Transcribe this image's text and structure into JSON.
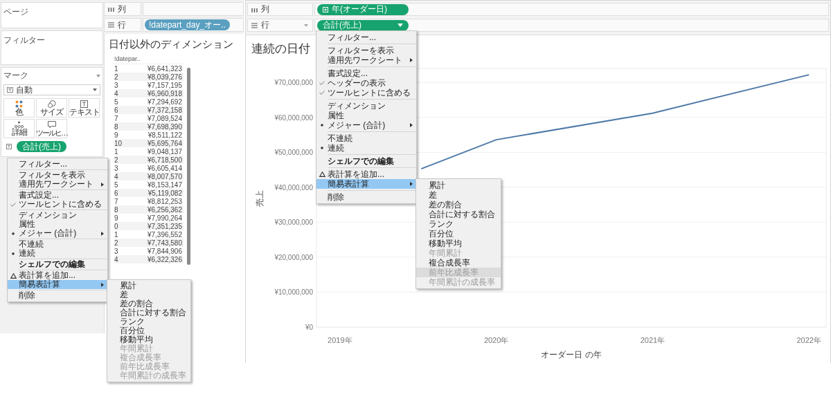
{
  "left": {
    "pages_card": {
      "title": "ページ"
    },
    "filters_card": {
      "title": "フィルター"
    },
    "marks_card": {
      "title": "マーク",
      "mark_type": "自動",
      "buttons": [
        {
          "label": "色",
          "kind": "color"
        },
        {
          "label": "サイズ",
          "kind": "size"
        },
        {
          "label": "テキスト",
          "kind": "text"
        },
        {
          "label": "詳細",
          "kind": "detail"
        },
        {
          "label": "ツールヒ…",
          "kind": "tooltip"
        }
      ],
      "pill": {
        "label": "合計(売上)",
        "continuous": true
      }
    },
    "shelves": [
      {
        "label": "列",
        "kind": "columns",
        "show_caret": false
      },
      {
        "label": "行",
        "kind": "rows",
        "show_caret": false,
        "pill": {
          "label": "!datepart_day_オー..",
          "continuous": false,
          "menu_open": false
        }
      }
    ],
    "sheet": {
      "title": "日付以外のディメンション",
      "column_1": "!datepar..",
      "rows": [
        [
          "1",
          "¥6,641,323"
        ],
        [
          "2",
          "¥8,039,276"
        ],
        [
          "3",
          "¥7,157,195"
        ],
        [
          "4",
          "¥6,960,918"
        ],
        [
          "5",
          "¥7,294,692"
        ],
        [
          "6",
          "¥7,372,158"
        ],
        [
          "7",
          "¥7,089,524"
        ],
        [
          "8",
          "¥7,698,390"
        ],
        [
          "9",
          "¥8,511,122"
        ],
        [
          "10",
          "¥5,695,764"
        ],
        [
          "1",
          "¥9,048,137"
        ],
        [
          "2",
          "¥6,718,500"
        ],
        [
          "3",
          "¥6,605,414"
        ],
        [
          "4",
          "¥8,007,570"
        ],
        [
          "5",
          "¥8,153,147"
        ],
        [
          "6",
          "¥5,119,082"
        ],
        [
          "7",
          "¥8,812,253"
        ],
        [
          "8",
          "¥6,256,362"
        ],
        [
          "9",
          "¥7,990,264"
        ],
        [
          "0",
          "¥7,351,235"
        ],
        [
          "1",
          "¥7,396,552"
        ],
        [
          "2",
          "¥7,743,580"
        ],
        [
          "3",
          "¥7,844,906"
        ],
        [
          "4",
          "¥6,322,326"
        ]
      ]
    },
    "menu": {
      "groups": [
        [
          {
            "label": "フィルター...",
            "kind": "plain",
            "selected": false
          }
        ],
        [
          {
            "label": "フィルターを表示",
            "kind": "plain",
            "selected": false
          },
          {
            "label": "適用先ワークシート",
            "kind": "plain",
            "submenu": true,
            "selected": false
          }
        ],
        [
          {
            "label": "書式設定...",
            "kind": "plain",
            "selected": false
          },
          {
            "label": "ツールヒントに含める",
            "kind": "check",
            "selected": false
          }
        ],
        [
          {
            "label": "ディメンション",
            "kind": "plain",
            "selected": false
          },
          {
            "label": "属性",
            "kind": "plain",
            "selected": false
          },
          {
            "label": "メジャー (合計)",
            "kind": "radio",
            "submenu": true,
            "selected": false
          }
        ],
        [
          {
            "label": "不連続",
            "kind": "plain",
            "selected": false
          },
          {
            "label": "連続",
            "kind": "radio",
            "selected": false
          }
        ],
        [
          {
            "label": "シェルフでの編集",
            "kind": "plain",
            "bold": true,
            "selected": false
          }
        ],
        [
          {
            "label": "表計算を追加...",
            "kind": "calc",
            "selected": false
          },
          {
            "label": "簡易表計算",
            "kind": "plain",
            "submenu": true,
            "selected": true
          }
        ],
        [
          {
            "label": "削除",
            "kind": "plain",
            "selected": false
          }
        ]
      ]
    },
    "submenu": {
      "items": [
        {
          "label": "累計",
          "disabled": false,
          "selected": false
        },
        {
          "label": "差",
          "disabled": false,
          "selected": false
        },
        {
          "label": "差の割合",
          "disabled": false,
          "selected": false
        },
        {
          "label": "合計に対する割合",
          "disabled": false,
          "selected": false
        },
        {
          "label": "ランク",
          "disabled": false,
          "selected": false
        },
        {
          "label": "百分位",
          "disabled": false,
          "selected": false
        },
        {
          "label": "移動平均",
          "disabled": false,
          "selected": false
        },
        {
          "label": "年間累計",
          "disabled": true,
          "selected": false
        },
        {
          "label": "複合成長率",
          "disabled": true,
          "selected": false
        },
        {
          "label": "前年比成長率",
          "disabled": true,
          "selected": false
        },
        {
          "label": "年間累計の成長率",
          "disabled": true,
          "selected": false
        }
      ]
    }
  },
  "right": {
    "shelves": [
      {
        "label": "列",
        "kind": "columns",
        "show_caret": false,
        "pill": {
          "label": "年(オーダー日)",
          "continuous": true,
          "kind": "date",
          "menu_open": false
        }
      },
      {
        "label": "行",
        "kind": "rows",
        "show_caret": true,
        "pill": {
          "label": "合計(売上)",
          "continuous": true,
          "kind": "measure",
          "menu_open": true
        }
      }
    ],
    "sheet": {
      "title": "連続の日付",
      "chart_data": {
        "type": "line",
        "xlabel": "オーダー日 の年",
        "ylabel": "売上",
        "x": [
          2019.52,
          2020,
          2021,
          2022
        ],
        "series": [
          {
            "color": "#4e79a7",
            "values": [
              45300000,
              53600000,
              61200000,
              72200000
            ]
          }
        ],
        "xlim": [
          2018.85,
          2022.11
        ],
        "ylim": [
          0,
          74000000
        ],
        "grid": true,
        "xticks": [
          {
            "value": 2019,
            "label": "2019年"
          },
          {
            "value": 2020,
            "label": "2020年"
          },
          {
            "value": 2021,
            "label": "2021年"
          },
          {
            "value": 2022,
            "label": "2022年"
          }
        ],
        "yticks": [
          {
            "value": 0,
            "label": "¥0"
          },
          {
            "value": 10000000,
            "label": "¥10,000,000"
          },
          {
            "value": 20000000,
            "label": "¥20,000,000"
          },
          {
            "value": 30000000,
            "label": "¥30,000,000"
          },
          {
            "value": 40000000,
            "label": "¥40,000,000"
          },
          {
            "value": 50000000,
            "label": "¥50,000,000"
          },
          {
            "value": 60000000,
            "label": "¥60,000,000"
          },
          {
            "value": 70000000,
            "label": "¥70,000,000"
          }
        ]
      }
    },
    "menu": {
      "groups": [
        [
          {
            "label": "フィルター...",
            "kind": "plain",
            "selected": false
          }
        ],
        [
          {
            "label": "フィルターを表示",
            "kind": "plain",
            "selected": false
          },
          {
            "label": "適用先ワークシート",
            "kind": "plain",
            "submenu": true,
            "selected": false
          }
        ],
        [
          {
            "label": "書式設定...",
            "kind": "plain",
            "selected": false
          },
          {
            "label": "ヘッダーの表示",
            "kind": "check",
            "selected": false
          },
          {
            "label": "ツールヒントに含める",
            "kind": "check",
            "selected": false
          }
        ],
        [
          {
            "label": "ディメンション",
            "kind": "plain",
            "selected": false
          },
          {
            "label": "属性",
            "kind": "plain",
            "selected": false
          },
          {
            "label": "メジャー (合計)",
            "kind": "radio",
            "submenu": true,
            "selected": false
          }
        ],
        [
          {
            "label": "不連続",
            "kind": "plain",
            "selected": false
          },
          {
            "label": "連続",
            "kind": "radio",
            "selected": false
          }
        ],
        [
          {
            "label": "シェルフでの編集",
            "kind": "plain",
            "bold": true,
            "selected": false
          }
        ],
        [
          {
            "label": "表計算を追加...",
            "kind": "calc",
            "selected": false
          },
          {
            "label": "簡易表計算",
            "kind": "plain",
            "submenu": true,
            "selected": true
          }
        ],
        [
          {
            "label": "削除",
            "kind": "plain",
            "selected": false
          }
        ]
      ]
    },
    "submenu": {
      "items": [
        {
          "label": "累計",
          "disabled": false,
          "selected": false
        },
        {
          "label": "差",
          "disabled": false,
          "selected": false
        },
        {
          "label": "差の割合",
          "disabled": false,
          "selected": false
        },
        {
          "label": "合計に対する割合",
          "disabled": false,
          "selected": false
        },
        {
          "label": "ランク",
          "disabled": false,
          "selected": false
        },
        {
          "label": "百分位",
          "disabled": false,
          "selected": false
        },
        {
          "label": "移動平均",
          "disabled": false,
          "selected": false
        },
        {
          "label": "年間累計",
          "disabled": true,
          "selected": false
        },
        {
          "label": "複合成長率",
          "disabled": false,
          "selected": false
        },
        {
          "label": "前年比成長率",
          "disabled": true,
          "selected": true
        },
        {
          "label": "年間累計の成長率",
          "disabled": true,
          "selected": false
        }
      ]
    }
  }
}
